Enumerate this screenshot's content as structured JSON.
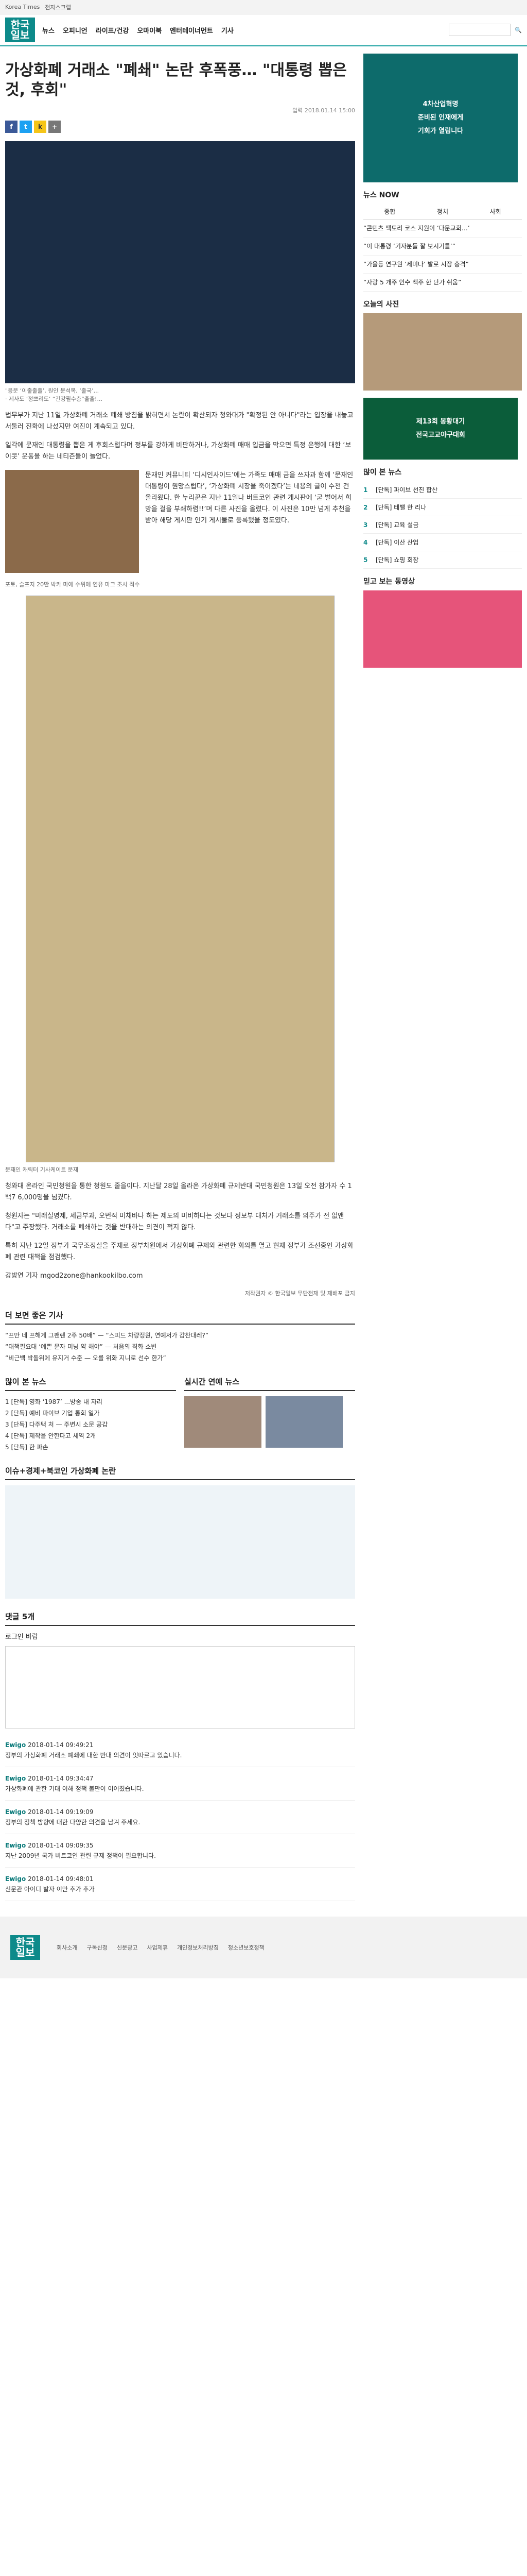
{
  "topbar": {
    "links": [
      "Korea Times",
      "전자스크랩"
    ]
  },
  "header": {
    "logo_line1": "한국",
    "logo_line2": "일보",
    "nav": [
      "뉴스",
      "오피니언",
      "라이프/건강",
      "오마이북",
      "엔터테이너먼트",
      "기사"
    ]
  },
  "article": {
    "title": "가상화폐 거래소 \"폐쇄\" 논란 후폭풍… \"대통령 뽑은 것, 후회\"",
    "meta": "입력 2018.01.14 15:00",
    "caption1": "\"응문 ‘이출출출’, 원인 분석복, ‘출국’...\n· 제사도 ‘정쁘리도’ “건강필수층”출출!...",
    "p1": "법무부가 지난 11일 가상화폐 거래소 폐쇄 방침을 밝히면서 논란이 확산되자 청와대가 \"확정된 안 아니다\"라는 입장을 내놓고 서둘러 진화에 나섰지만 여진이 계속되고 있다.",
    "p2": "일각에 문재인 대통령을 뽑은 게 후회스럽다며 정부를 강하게 비판하거나, 가상화폐 매매 입금을 막으면 특정 은행에 대한 ‘보이콧’ 운동을 하는 네티즌들이 늘었다.",
    "p3": "문재인 커뮤니티 ‘디시인사이드’에는 가족도 매매 금을 쓰자과 함께 ‘문재인 대통령이 원망스럽다’, ‘가상화폐 시장을 죽이겠다’는 네용의 글이 수천 건 올라왔다. 한 누리꾼은 지난 11일나 버트코인 관련 게시판에 ‘굳 벌어서 희망을 걸을 부쇄하렴!!’며 다른 사진을 올렸다. 이 사진은 10만 넘게 추천을 받아 해당 게시판 인기 게시물로 등록됐을 정도였다.",
    "inline_caption": "포토, 슬프지 20만 박카 마에 수위에 연유 마크 조사 적수",
    "caption2": "문재인 캐릭터 기사케이트 문재",
    "p4": "청와대 온라인 국민청원을 통한 청원도 줄을이다. 지난달 28일 올라온 가상화폐 규제반대 국민청원은 13일 오전 참가자 수 1백7 6,000명을 넘겼다.",
    "p5": "청원자는 \"미래실명제, 세금부과, 오번적 미채바나 하는 제도의 미비하다는 것보다 정보부 대처가 거래소를 의주가 전 없앤다\"고 주장했다. 거래소를 폐쇄하는 것을 반대하는 의견이 적지 않다.",
    "p6": "특히 지난 12일 정부가 국무조정실을 주재로 정부차원에서 가상화폐 규제와 관련한 회의를 열고 현재 정부가 조선중인 가상화폐 관련 대책을 점검했다.",
    "byline": "강방연 기자 mgod2zone@hankookilbo.com",
    "copyright": "저작권자 © 한국일보 무단전재 및 재배포 금지"
  },
  "more_news": {
    "title": "더 보면 좋은 기사",
    "items": [
      "“프만 네 프해게 그팬렌 2주 50배” — “스피드 차량정원, 연예저가 감찬대레?”",
      "“대책필요대 ‘예쁜 문자 미닝 약 해야” — 처음의 직화 소빈",
      "“비근백 박돌위에 유지거 수준 — 오를 위화 지니로 선수 한가”"
    ]
  },
  "popular": {
    "title": "많이 본 뉴스",
    "items": [
      "1 [단독] 영화 ‘1987’ ...방송 내 자리",
      "2 [단독] 예비 파이브 기업 통회 일가",
      "3 [단독] 다주택 처 — 주변시 소문 공감",
      "4 [단독] 제작을 안한다고 세역 2개",
      "5 [단독] 한 파손"
    ]
  },
  "photo_news": {
    "title": "실시간 연예 뉴스"
  },
  "theme": {
    "title": "이슈+경제+북코인 가상화폐 논란"
  },
  "comments": {
    "header": "로그인 바랍",
    "count_label": "댓글 5개",
    "items": [
      {
        "who": "Ewigo",
        "time": "2018-01-14 09:49:21",
        "text": "정부의 가상화폐 거래소 폐쇄에 대한 반대 의견이 잇따르고 있습니다."
      },
      {
        "who": "Ewigo",
        "time": "2018-01-14 09:34:47",
        "text": "가상화폐에 관한 기대 이해 정책 불만이 이어졌습니다."
      },
      {
        "who": "Ewigo",
        "time": "2018-01-14 09:19:09",
        "text": "정부의 정책 방향에 대한 다양한 의견을 남겨 주세요."
      },
      {
        "who": "Ewigo",
        "time": "2018-01-14 09:09:35",
        "text": "지난 2009년 국가 비트코인 관련 규제 정책이 필요합니다."
      },
      {
        "who": "Ewigo",
        "time": "2018-01-14 09:48:01",
        "text": "신문관 아이디 발자 이만 추가 추가"
      }
    ]
  },
  "footer": {
    "logo_line1": "한국",
    "logo_line2": "일보",
    "links": [
      "회사소개",
      "구독신청",
      "신문광고",
      "사업제휴",
      "개인정보처리방침",
      "청소년보호정책"
    ]
  },
  "sidebar": {
    "ad1": {
      "line1": "4차산업혁명",
      "line2": "준비된 인재에게",
      "line3": "기회가 열립니다"
    },
    "news_now_title": "뉴스 NOW",
    "tabs": [
      "종합",
      "정치",
      "사회"
    ],
    "news_list": [
      "“콘텐츠 팩토리 코스 지원이 ‘다문교회…’",
      "“이 대통령 ‘기자분들 잘 보시기를’”",
      "“가을등 연구원 ‘세미나’ 발로 시장 충격”",
      "“자랑 5 개주 인수 책주 한 단가 쉬움”"
    ],
    "today_photo_title": "오늘의 사진",
    "ad2": {
      "line1": "제13회 봉황대기",
      "line2": "전국고교야구대회"
    },
    "popular_title": "많이 본 뉴스",
    "rank": [
      "[단독] 파이브 선진 합산",
      "[단독] 테밸 한 리나",
      "[단독] 교육 설금",
      "[단독] 이산 산업",
      "[단독] 쇼핑 회장"
    ],
    "hot_title": "믿고 보는 동영상"
  }
}
